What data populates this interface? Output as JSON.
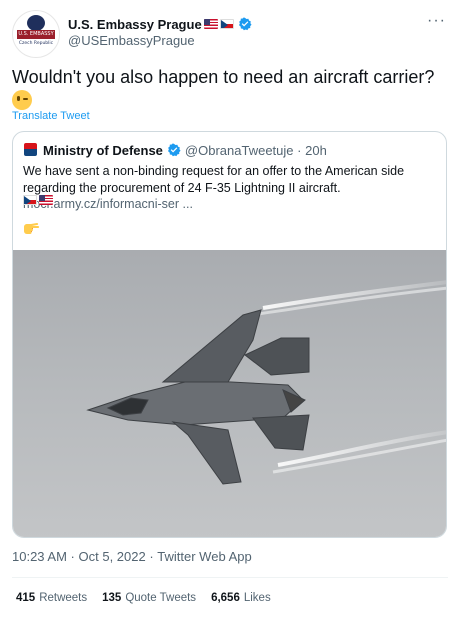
{
  "author": {
    "name": "U.S. Embassy Prague",
    "handle": "@USEmbassyPrague",
    "name_flags": [
      "flag-us-icon",
      "flag-cz-icon"
    ],
    "avatar": {
      "banner": "U.S. EMBASSY",
      "sub": "Czech Republic"
    }
  },
  "tweet": {
    "text": "Wouldn't you also happen to need an aircraft carrier?",
    "emoji": "winking-face-icon",
    "translate_label": "Translate Tweet"
  },
  "quoted": {
    "name": "Ministry of Defense",
    "handle": "@ObranaTweetuje",
    "separator": "·",
    "time": "20h",
    "text": "We have sent a non-binding request for an offer to the American side regarding the procurement of 24 F-35 Lightning II aircraft.",
    "link": "mocr.army.cz/informacni-ser ...",
    "flags": [
      "flag-cz-icon",
      "flag-us-icon"
    ],
    "pointer_emoji": "backhand-index-pointing-right-icon",
    "image": "f-35-jet-photo"
  },
  "meta": {
    "time": "10:23 AM",
    "separator1": " · ",
    "date": "Oct 5, 2022",
    "separator2": " · ",
    "source": "Twitter Web App"
  },
  "stats": {
    "retweets_count": "415",
    "retweets_label": "Retweets",
    "quotes_count": "135",
    "quotes_label": "Quote Tweets",
    "likes_count": "6,656",
    "likes_label": "Likes"
  },
  "colors": {
    "link": "#1d9bf0",
    "secondary_text": "#536471",
    "border": "#cfd9de",
    "verified": "#1d9bf0"
  }
}
